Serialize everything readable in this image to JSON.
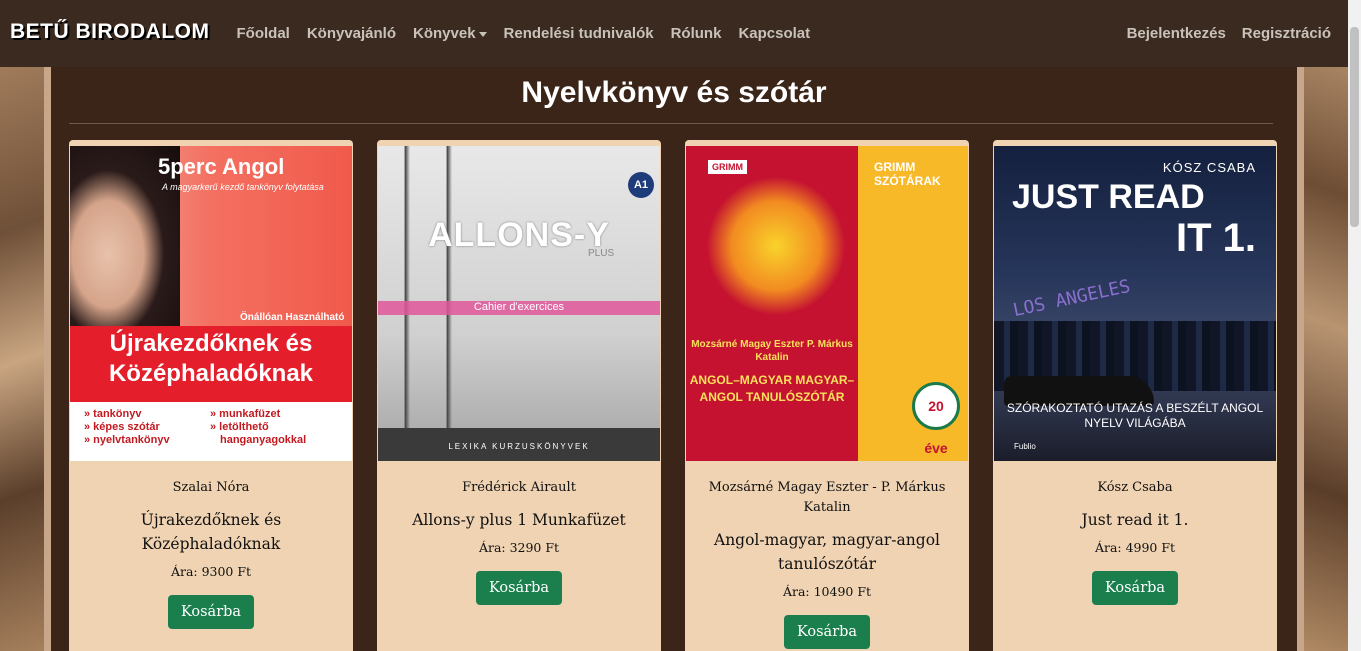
{
  "navbar": {
    "brand": "BETŰ BIRODALOM",
    "links": [
      "Főoldal",
      "Könyvajánló",
      "Könyvek",
      "Rendelési tudnivalók",
      "Rólunk",
      "Kapcsolat"
    ],
    "right_links": [
      "Bejelentkezés",
      "Regisztráció"
    ]
  },
  "page": {
    "title": "Nyelvkönyv és szótár"
  },
  "cart_label": "Kosárba",
  "books": [
    {
      "author": "Szalai Nóra",
      "title": "Újrakezdőknek és Középhaladóknak",
      "price": "Ára: 9300 Ft",
      "cover": {
        "brand": "5perc Angol",
        "tagline": "A magyarkerű kezdő tankönyv folytatása",
        "note": "Önállóan Használható",
        "headline": "Újrakezdőknek és Középhaladóknak",
        "features": [
          "» tankönyv",
          "» képes szótár",
          "» nyelvtankönyv",
          "» munkafüzet",
          "» letölthető",
          "hanganyagokkal"
        ]
      }
    },
    {
      "author": "Frédérick Airault",
      "title": "Allons-y plus 1 Munkafüzet",
      "price": "Ára: 3290 Ft",
      "cover": {
        "logo": "ALLONS-Y",
        "plus": "PLUS",
        "level": "A1",
        "subtitle": "Cahier d'exercices",
        "series": "LEXIKA KURZUSKÖNYVEK"
      }
    },
    {
      "author": "Mozsárné Magay Eszter - P. Márkus Katalin",
      "title": "Angol-magyar, magyar-angol tanulószótár",
      "price": "Ára: 10490 Ft",
      "cover": {
        "publisher_tag": "GRIMM",
        "series": "GRIMM SZÓTÁRAK",
        "authors": "Mozsárné Magay Eszter P. Márkus Katalin",
        "headline": "ANGOL–MAGYAR MAGYAR–ANGOL TANULÓSZÓTÁR",
        "badge": "20 éve"
      }
    },
    {
      "author": "Kósz Csaba",
      "title": "Just read it 1.",
      "price": "Ára: 4990 Ft",
      "cover": {
        "author": "KÓSZ CSABA",
        "title_line1": "JUST READ",
        "title_line2": "IT 1.",
        "city": "LOS ANGELES",
        "subtitle": "SZÓRAKOZTATÓ UTAZÁS A BESZÉLT ANGOL NYELV VILÁGÁBA",
        "publisher": "Fublio"
      }
    }
  ]
}
